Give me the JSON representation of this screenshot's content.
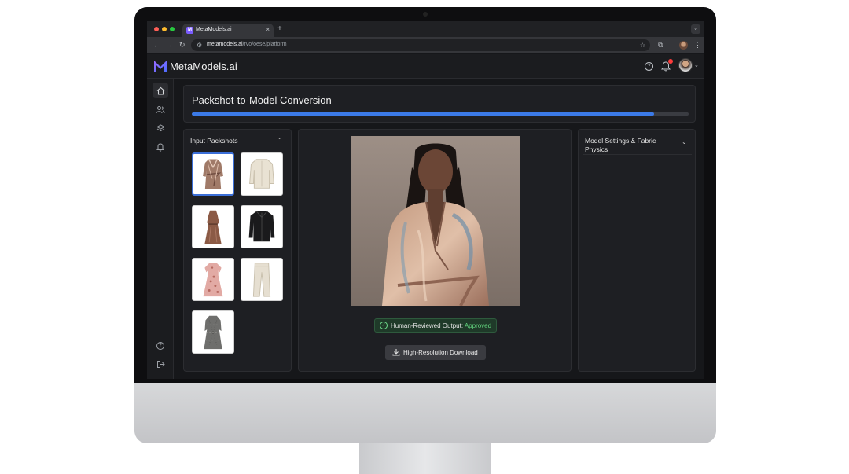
{
  "browser": {
    "tab_title": "MetaModels.ai",
    "tab_close": "×",
    "new_tab": "+",
    "url_host": "metamodels.ai",
    "url_path": "/rvo/oese/platform"
  },
  "app": {
    "brand": "MetaModels.ai"
  },
  "conversion": {
    "title": "Packshot-to-Model Conversion",
    "progress_percent": 93,
    "progress_color": "#3b7ae8"
  },
  "packshots": {
    "title": "Input Packshots",
    "items": [
      {
        "name": "satin print wrap dress",
        "selected": true
      },
      {
        "name": "cream blouse",
        "selected": false
      },
      {
        "name": "brown midi dress",
        "selected": false
      },
      {
        "name": "black jacket",
        "selected": false
      },
      {
        "name": "pink floral dress",
        "selected": false
      },
      {
        "name": "cream trousers",
        "selected": false
      },
      {
        "name": "grey pattern dress",
        "selected": false
      }
    ]
  },
  "output": {
    "badge_label": "Human-Reviewed Output:",
    "badge_status": "Approved",
    "download_label": "High-Resolution Download"
  },
  "settings": {
    "title": "Model Settings & Fabric Physics"
  },
  "colors": {
    "accent": "#3b7ae8",
    "approved": "#62d47e",
    "brand_logo": "#7b5cff"
  }
}
